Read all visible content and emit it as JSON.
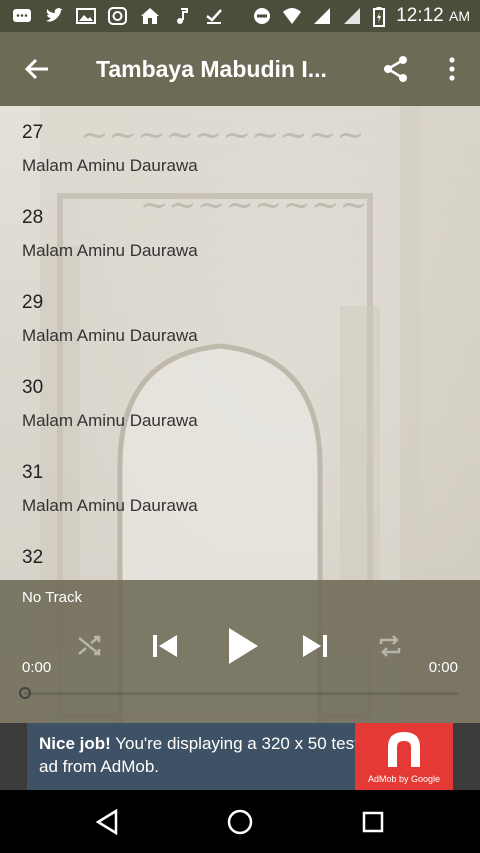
{
  "status_bar": {
    "time": "12:12",
    "ampm": "AM",
    "icons": [
      "message-icon",
      "twitter-icon",
      "image-icon",
      "instagram-icon",
      "home-app-icon",
      "music-icon",
      "download-done-icon",
      "dnd-icon",
      "wifi-icon",
      "signal-icon",
      "signal-icon-2",
      "battery-icon"
    ]
  },
  "toolbar": {
    "title": "Tambaya Mabudin I...",
    "back_icon": "arrow-back-icon",
    "share_icon": "share-icon",
    "more_icon": "more-vert-icon"
  },
  "tracks": [
    {
      "number": "27",
      "artist": "Malam Aminu Daurawa"
    },
    {
      "number": "28",
      "artist": "Malam Aminu Daurawa"
    },
    {
      "number": "29",
      "artist": "Malam Aminu Daurawa"
    },
    {
      "number": "30",
      "artist": "Malam Aminu Daurawa"
    },
    {
      "number": "31",
      "artist": "Malam Aminu Daurawa"
    },
    {
      "number": "32",
      "artist": ""
    }
  ],
  "player": {
    "track_name": "No Track",
    "current_time": "0:00",
    "total_time": "0:00",
    "progress": 0,
    "icons": [
      "shuffle-icon",
      "skip-previous-icon",
      "play-icon",
      "skip-next-icon",
      "repeat-icon"
    ]
  },
  "ad": {
    "headline": "Nice job!",
    "body": " You're displaying a 320 x 50 test ad from AdMob.",
    "logo_caption": "AdMob by Google",
    "bg_color": "#3f5265",
    "logo_color": "#e53935"
  },
  "nav_bar": {
    "icons": [
      "back-triangle-icon",
      "home-circle-icon",
      "recents-square-icon"
    ]
  }
}
